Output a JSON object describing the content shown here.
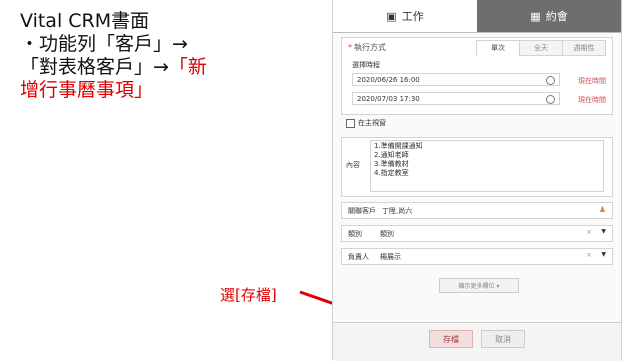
{
  "caption": {
    "line1": "Vital CRM書面",
    "line2": "・功能列「客戶」→",
    "line3_a": "「對表格客戶」→",
    "line3_b": "「新",
    "line4": "增行事曆事項」"
  },
  "pointer_label": "選[存檔]",
  "tabs": [
    {
      "label": "工作",
      "icon": "calendar-icon"
    },
    {
      "label": "約會",
      "icon": "calendar-grid-icon"
    }
  ],
  "schedule": {
    "mode_label": "執行方式",
    "subtabs": [
      "單次",
      "全天",
      "週期性"
    ],
    "select_time_label": "選擇時程",
    "start": "2020/06/26 16:00",
    "end": "2020/07/03 17:30",
    "now_link": "現在時間"
  },
  "checkbox_label": "在主視窗",
  "content": {
    "label": "內容",
    "lines": [
      "1.準備開課通知",
      "2.通知老師",
      "3.準備教材",
      "4.指定教室"
    ]
  },
  "fields": {
    "related_customer": {
      "label": "關聯客戶",
      "value": "丁陞,尚六"
    },
    "category": {
      "label": "類別",
      "value": "類別"
    },
    "owner": {
      "label": "負責人",
      "value": "楊展示"
    }
  },
  "more_fields_label": "顯示更多欄位 ▾",
  "buttons": {
    "save": "存檔",
    "cancel": "取消"
  },
  "colors": {
    "accent_red": "#e00000",
    "tab_inactive": "#6e6e6e"
  }
}
